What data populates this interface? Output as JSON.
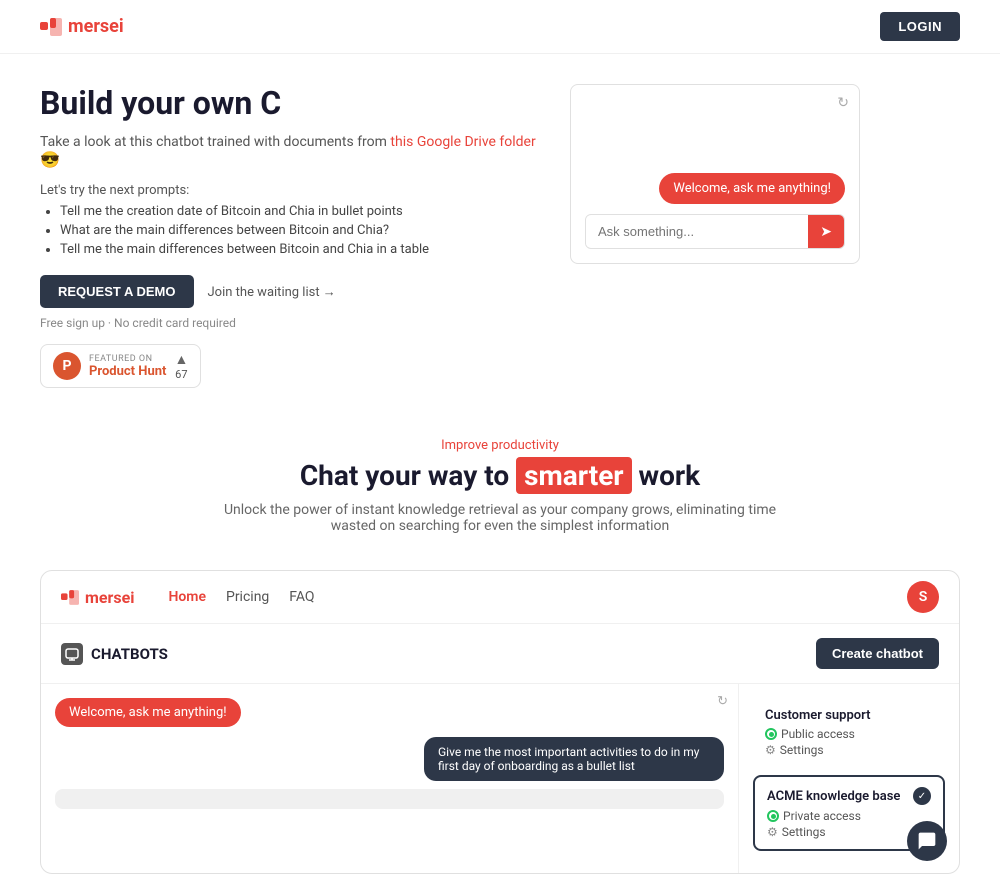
{
  "nav": {
    "logo_text": "mersei",
    "login_label": "LOGIN"
  },
  "hero": {
    "title": "Build your own C",
    "subtitle_prefix": "Take a look at this chatbot trained with documents from",
    "subtitle_link": "this Google Drive folder",
    "subtitle_emoji": "😎",
    "prompts_label": "Let's try the next prompts:",
    "prompts": [
      "Tell me the creation date of Bitcoin and Chia in bullet points",
      "What are the main differences between Bitcoin and Chia?",
      "Tell me the main differences between Bitcoin and Chia in a table"
    ],
    "request_demo_label": "REQUEST A DEMO",
    "join_waiting_label": "Join the waiting list →",
    "free_signup_label": "Free sign up · No credit card required",
    "product_hunt": {
      "featured_label": "FEATURED ON",
      "name": "Product Hunt",
      "arrow": "▲",
      "votes": "67"
    },
    "chatbot": {
      "welcome_text": "Welcome, ask me anything!",
      "input_placeholder": "Ask something..."
    }
  },
  "middle": {
    "improve_label": "Improve productivity",
    "tagline_before": "Chat your way to",
    "tagline_highlight": "smarter",
    "tagline_after": "work",
    "sub_text": "Unlock the power of instant knowledge retrieval as your company grows, eliminating time wasted on searching for even the simplest information"
  },
  "app": {
    "logo_text": "mersei",
    "nav_links": [
      {
        "label": "Home",
        "active": true
      },
      {
        "label": "Pricing",
        "active": false
      },
      {
        "label": "FAQ",
        "active": false
      }
    ],
    "avatar_initial": "S",
    "chatbots_title": "CHATBOTS",
    "create_chatbot_label": "Create chatbot",
    "chat": {
      "welcome_text": "Welcome, ask me anything!",
      "user_message": "Give me the most important activities to do in my first day of onboarding as a bullet list"
    },
    "bots": [
      {
        "name": "Customer support",
        "access": "Public access",
        "settings": "Settings",
        "selected": false,
        "check": false
      },
      {
        "name": "ACME knowledge base",
        "access": "Private access",
        "settings": "Settings",
        "selected": true,
        "check": true
      }
    ]
  },
  "icons": {
    "mersei_logo": "▪▪",
    "send": "➤",
    "refresh": "↻",
    "chat_bubble": "💬",
    "gear": "⚙"
  }
}
